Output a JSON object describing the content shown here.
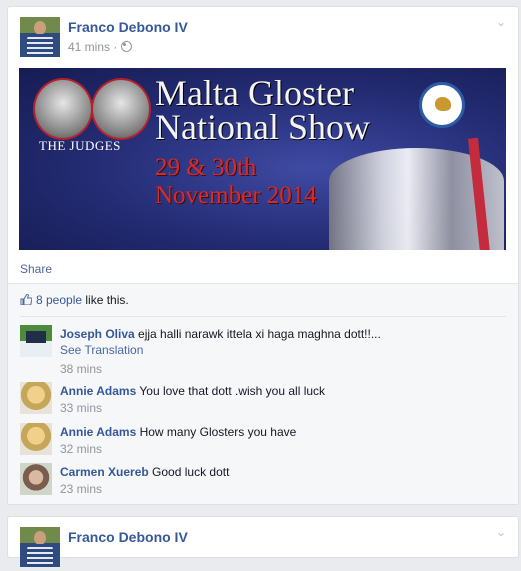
{
  "post": {
    "author": "Franco Debono IV",
    "time": "41 mins",
    "banner": {
      "judges_label": "THE JUDGES",
      "title_line1": "Malta Gloster",
      "title_line2": "National Show",
      "dates_line1": "29 & 30th",
      "dates_line2": "November 2014"
    },
    "share_label": "Share",
    "likes": {
      "count_text": "8 people",
      "suffix": " like this."
    },
    "comments": [
      {
        "name": "Joseph Oliva",
        "text": "ejja halli narawk ittela xi haga maghna dott!!...",
        "translation": "See Translation",
        "time": "38 mins"
      },
      {
        "name": "Annie Adams",
        "text": "You love that dott .wish you all luck",
        "time": "33 mins"
      },
      {
        "name": "Annie Adams",
        "text": "How many Glosters you have",
        "time": "32 mins"
      },
      {
        "name": "Carmen Xuereb",
        "text": "Good luck dott",
        "time": "23 mins"
      }
    ]
  },
  "next_post": {
    "author": "Franco Debono IV"
  },
  "colors": {
    "link": "#365899",
    "muted": "#90949c",
    "page_bg": "#e9ebee"
  }
}
